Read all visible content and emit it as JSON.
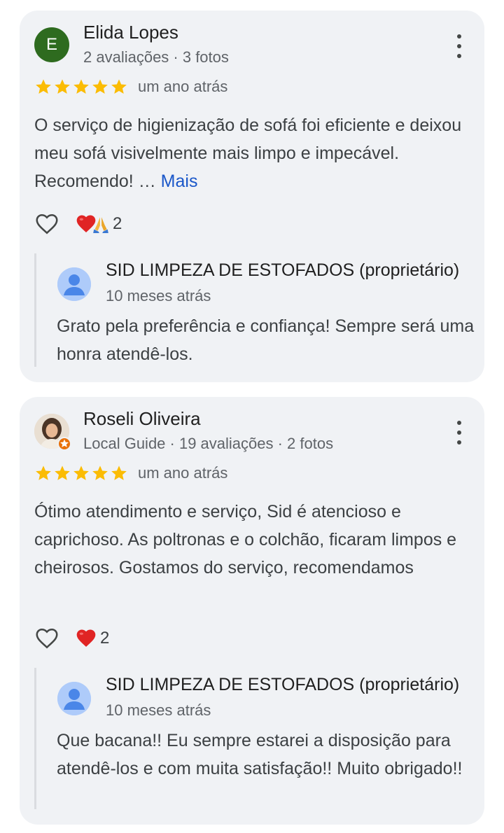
{
  "reviews": [
    {
      "avatar_letter": "E",
      "avatar_color": "#2e6b1f",
      "name": "Elida Lopes",
      "meta": "2 avaliações · 3 fotos",
      "rating": 5,
      "time": "um ano atrás",
      "text": "O serviço de higienização de sofá foi eficiente e deixou meu sofá visivelmente mais limpo e impecável. Recomendo! …",
      "more_label": "Mais",
      "reaction_count": "2",
      "reply": {
        "name": "SID LIMPEZA DE ESTOFADOS (proprietário)",
        "time": "10 meses atrás",
        "text": "Grato pela preferência e confiança! Sempre será uma honra atendê-los."
      }
    },
    {
      "avatar_letter": "",
      "name": "Roseli Oliveira",
      "meta": "Local Guide · 19 avaliações · 2 fotos",
      "rating": 5,
      "time": "um ano atrás",
      "text": "Ótimo atendimento e serviço, Sid é atencioso e caprichoso. As poltronas e o colchão, ficaram limpos e cheirosos. Gostamos do serviço, recomendamos",
      "reaction_count": "2",
      "reply": {
        "name": "SID LIMPEZA DE ESTOFADOS (proprietário)",
        "time": "10 meses atrás",
        "text": "Que bacana!! Eu sempre estarei a disposição para atendê-los e com muita satisfação!! Muito obrigado!!"
      }
    }
  ],
  "colors": {
    "card_bg": "#f0f2f5",
    "star": "#fbbc04",
    "link": "#1a57c9",
    "reaction_heart": "#e02424"
  },
  "icons": [
    "more-vert-icon",
    "star-icon",
    "heart-outline-icon",
    "heart-emoji-icon",
    "pray-emoji-icon",
    "local-guide-badge-icon",
    "default-avatar-icon"
  ]
}
